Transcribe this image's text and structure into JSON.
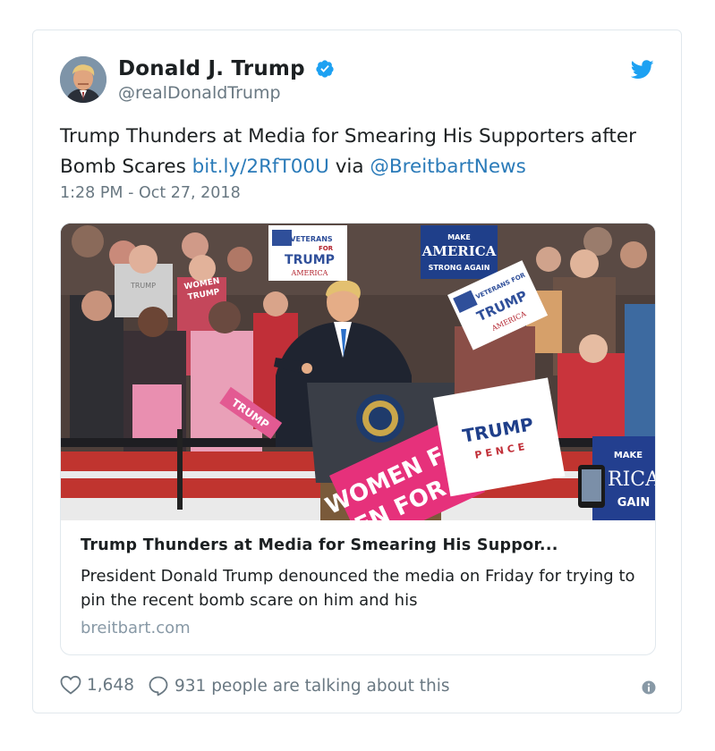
{
  "user": {
    "display_name": "Donald J. Trump",
    "handle": "@realDonaldTrump",
    "verified_icon": "verified-badge-icon",
    "avatar_icon": "avatar"
  },
  "tweet": {
    "text_prefix": "Trump Thunders at Media for Smearing His Supporters after Bomb Scares ",
    "link_text": "bit.ly/2RfT00U",
    "via_text": " via ",
    "mention_text": "@BreitbartNews",
    "timestamp": "1:28 PM - Oct 27, 2018"
  },
  "card": {
    "image_signs": {
      "veterans_top": "VETERANS",
      "veterans_for": "FOR",
      "veterans_trump": "TRUMP",
      "veterans_bottom": "AMERICA",
      "maga_make": "MAKE",
      "maga_america": "AMERICA",
      "maga_strong": "STRONG AGAIN",
      "women_for": "WOMEN FOR",
      "women_trump": "TRUMP",
      "shirt_women": "WOMEN",
      "shirt_trump": "TRUMP",
      "trump_pence_trump": "TRUMP",
      "trump_pence_pence": "PENCE",
      "vet_tilt_top": "VETERANS FOR",
      "vet_tilt_trump": "TRUMP",
      "vet_tilt_bottom": "AMERICA",
      "pink_sign": "WOMEN FOR TRUMP",
      "right_make": "MAKE",
      "right_rica": "RICA",
      "right_gain": "GAIN",
      "shirt_trump2": "TRUMP"
    },
    "title": "Trump Thunders at Media for Smearing His Suppor...",
    "description": "President Donald Trump denounced the media on Friday for trying to pin the recent bomb scare on him and his",
    "domain": "breitbart.com"
  },
  "footer": {
    "likes": "1,648",
    "conversation": "931 people are talking about this"
  },
  "colors": {
    "link": "#2b7bb9",
    "verified": "#1da1f2",
    "muted": "#697882"
  }
}
